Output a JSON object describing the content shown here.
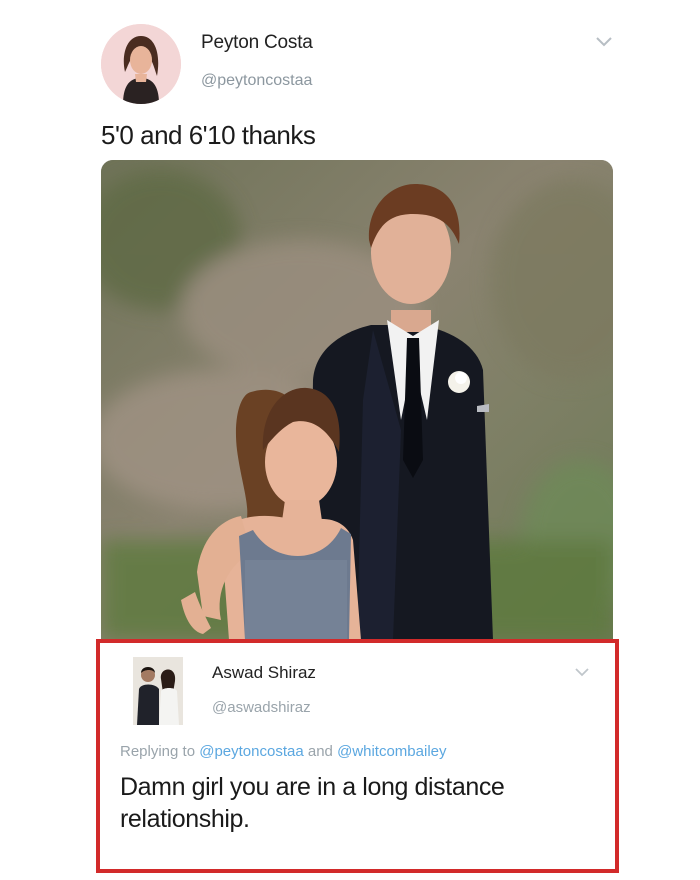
{
  "tweet": {
    "author_name": "Peyton Costa",
    "author_handle": "@peytoncostaa",
    "text": "5'0 and 6'10 thanks",
    "avatar_icon": "profile-photo",
    "menu_icon": "chevron-down-icon",
    "image_icon": "prom-photo"
  },
  "reply": {
    "author_name": "Aswad Shiraz",
    "author_handle": "@aswadshiraz",
    "replying_prefix": "Replying to",
    "mention_1": "@peytoncostaa",
    "conjunction": "and",
    "mention_2": "@whitcombailey",
    "text": "Damn girl you are in a long distance relationship.",
    "highlight_color": "#d22a2a",
    "mention_color": "#5ba7e0"
  }
}
